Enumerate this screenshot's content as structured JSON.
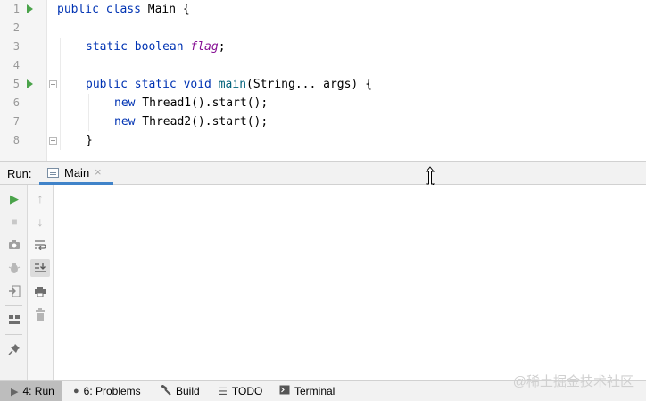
{
  "editor": {
    "lines": [
      {
        "n": "1",
        "run": true,
        "fold": false
      },
      {
        "n": "2",
        "run": false,
        "fold": false
      },
      {
        "n": "3",
        "run": false,
        "fold": false
      },
      {
        "n": "4",
        "run": false,
        "fold": false
      },
      {
        "n": "5",
        "run": true,
        "fold": true
      },
      {
        "n": "6",
        "run": false,
        "fold": false
      },
      {
        "n": "7",
        "run": false,
        "fold": false
      },
      {
        "n": "8",
        "run": false,
        "fold": true
      }
    ],
    "code": {
      "l1_kw": "public class",
      "l1_rest": " Main {",
      "l3_kw": "static boolean",
      "l3_field": "flag",
      "l3_end": ";",
      "l5_kw": "public static void",
      "l5_fn": "main",
      "l5_rest": "(String... args) {",
      "l6_kw": "new",
      "l6_rest": " Thread1().start();",
      "l7_kw": "new",
      "l7_rest": " Thread2().start();",
      "l8": "}"
    }
  },
  "run_window": {
    "label": "Run:",
    "tab_label": "Main",
    "tab_close": "×"
  },
  "left_toolbar": [
    {
      "name": "rerun-icon",
      "glyph": "▶"
    },
    {
      "name": "stop-icon",
      "glyph": "■"
    },
    {
      "name": "camera-icon",
      "glyph": "📷"
    },
    {
      "name": "bug-icon",
      "glyph": "✱"
    },
    {
      "name": "exit-icon",
      "glyph": "⇥"
    },
    {
      "name": "layout-icon",
      "glyph": "▦"
    },
    {
      "name": "pin-icon",
      "glyph": "📌"
    }
  ],
  "right_toolbar": [
    {
      "name": "up-arrow-icon",
      "glyph": "↑"
    },
    {
      "name": "down-arrow-icon",
      "glyph": "↓"
    },
    {
      "name": "soft-wrap-icon",
      "glyph": "⮐"
    },
    {
      "name": "scroll-to-end-icon",
      "glyph": "⤓"
    },
    {
      "name": "print-icon",
      "glyph": "🖶"
    },
    {
      "name": "trash-icon",
      "glyph": "🗑"
    }
  ],
  "bottom_tabs": [
    {
      "label": "4: Run",
      "icon": "▶"
    },
    {
      "label": "6: Problems",
      "icon": "❶"
    },
    {
      "label": "Build",
      "icon": "🔨"
    },
    {
      "label": "TODO",
      "icon": "☰"
    },
    {
      "label": "Terminal",
      "icon": "▣"
    }
  ],
  "watermark": "@稀土掘金技术社区",
  "colors": {
    "keyword": "#0033b3",
    "field": "#871094",
    "method": "#00627a",
    "run_green": "#4aa34a",
    "tab_accent": "#4083c9"
  }
}
